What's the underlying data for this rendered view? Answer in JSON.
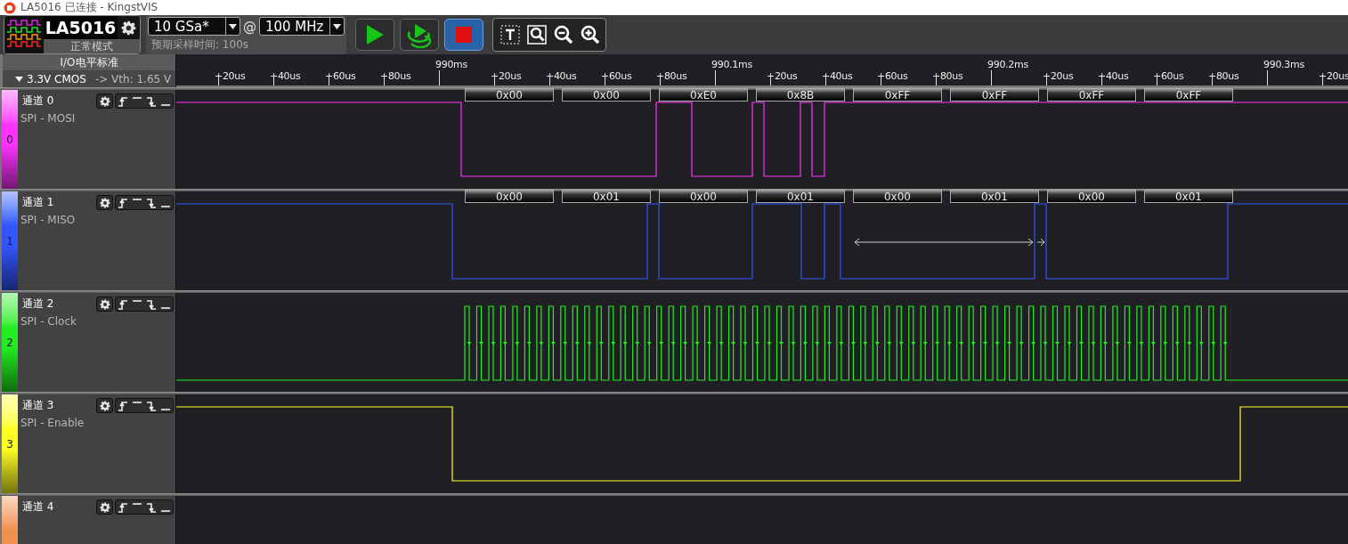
{
  "window": {
    "title": "LA5016 已连接 - KingstVIS"
  },
  "device": {
    "name": "LA5016",
    "mode": "正常模式"
  },
  "sampling": {
    "depth": "10 GSa*",
    "at": "@",
    "rate": "100 MHz",
    "expected_time": "预期采样时间: 100s"
  },
  "run_buttons": [
    {
      "kind": "start",
      "active": false
    },
    {
      "kind": "loop",
      "active": false
    },
    {
      "kind": "stop",
      "active": true
    }
  ],
  "tools": [
    {
      "kind": "text"
    },
    {
      "kind": "zoom_fit"
    },
    {
      "kind": "zoom_out"
    },
    {
      "kind": "zoom_in"
    }
  ],
  "io_standard": {
    "title": "I/O电平标准",
    "level": "3.3V CMOS",
    "threshold": "-> Vth: 1.65 V"
  },
  "ruler": [
    {
      "label": "+20us",
      "major": false
    },
    {
      "label": "+40us",
      "major": false
    },
    {
      "label": "+60us",
      "major": false
    },
    {
      "label": "+80us",
      "major": false
    },
    {
      "label": "990ms",
      "major": true
    },
    {
      "label": "+20us",
      "major": false
    },
    {
      "label": "+40us",
      "major": false
    },
    {
      "label": "+60us",
      "major": false
    },
    {
      "label": "+80us",
      "major": false
    },
    {
      "label": "990.1ms",
      "major": true
    },
    {
      "label": "+20us",
      "major": false
    },
    {
      "label": "+40us",
      "major": false
    },
    {
      "label": "+60us",
      "major": false
    },
    {
      "label": "+80us",
      "major": false
    },
    {
      "label": "990.2ms",
      "major": true
    },
    {
      "label": "+20us",
      "major": false
    },
    {
      "label": "+40us",
      "major": false
    },
    {
      "label": "+60us",
      "major": false
    },
    {
      "label": "+80us",
      "major": false
    },
    {
      "label": "990.3ms",
      "major": true
    },
    {
      "label": "+20us",
      "major": false
    }
  ],
  "channels": [
    {
      "name": "通道 0",
      "protocol": "SPI - MOSI",
      "index": "0",
      "color": "#ff33ff",
      "kind": "mosi",
      "decoded": [
        "0x00",
        "0x00",
        "0xE0",
        "0x8B",
        "0xFF",
        "0xFF",
        "0xFF",
        "0xFF"
      ]
    },
    {
      "name": "通道 1",
      "protocol": "SPI - MISO",
      "index": "1",
      "color": "#3355ff",
      "kind": "miso",
      "decoded": [
        "0x00",
        "0x01",
        "0x00",
        "0x01",
        "0x00",
        "0x01",
        "0x00",
        "0x01"
      ]
    },
    {
      "name": "通道 2",
      "protocol": "SPI - Clock",
      "index": "2",
      "color": "#22ee22",
      "kind": "clock"
    },
    {
      "name": "通道 3",
      "protocol": "SPI - Enable",
      "index": "3",
      "color": "#ffff22",
      "kind": "enable"
    },
    {
      "name": "通道 4",
      "color": "#f09050",
      "kind": "idle"
    }
  ]
}
